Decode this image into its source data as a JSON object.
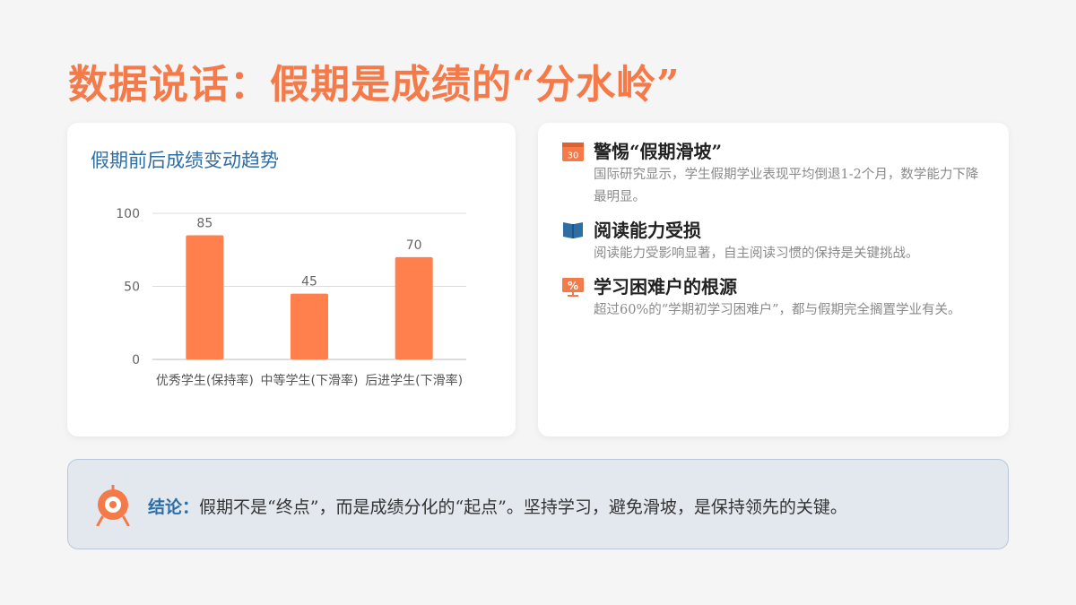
{
  "page": {
    "title": "数据说话：假期是成绩的“分水岭”"
  },
  "chart_card": {
    "title": "假期前后成绩变动趋势"
  },
  "chart_data": {
    "type": "bar",
    "title": "假期前后成绩变动趋势",
    "categories": [
      "优秀学生(保持率)",
      "中等学生(下滑率)",
      "后进学生(下滑率)"
    ],
    "values": [
      85,
      45,
      70
    ],
    "ylim": [
      0,
      100
    ],
    "yticks": [
      0,
      50,
      100
    ],
    "grid": true,
    "bar_color": "#ff7f4d"
  },
  "info": {
    "items": [
      {
        "icon": "calendar-icon",
        "title": "警惕“假期滑坡”",
        "desc": "国际研究显示，学生假期学业表现平均倒退1-2个月，数学能力下降最明显。",
        "icon_text": "30"
      },
      {
        "icon": "book-icon",
        "title": "阅读能力受损",
        "desc": "阅读能力受影响显著，自主阅读习惯的保持是关键挑战。"
      },
      {
        "icon": "percent-board-icon",
        "title": "学习困难户的根源",
        "desc": "超过60%的“学期初学习困难户”，都与假期完全搁置学业有关。",
        "icon_text": "%"
      }
    ]
  },
  "conclusion": {
    "icon": "target-icon",
    "label": "结论：",
    "text": "假期不是“终点”，而是成绩分化的“起点”。坚持学习，避免滑坡，是保持领先的关键。"
  },
  "colors": {
    "accent": "#f47a4a",
    "blue": "#2f6ea5",
    "background": "#f5f5f5"
  }
}
